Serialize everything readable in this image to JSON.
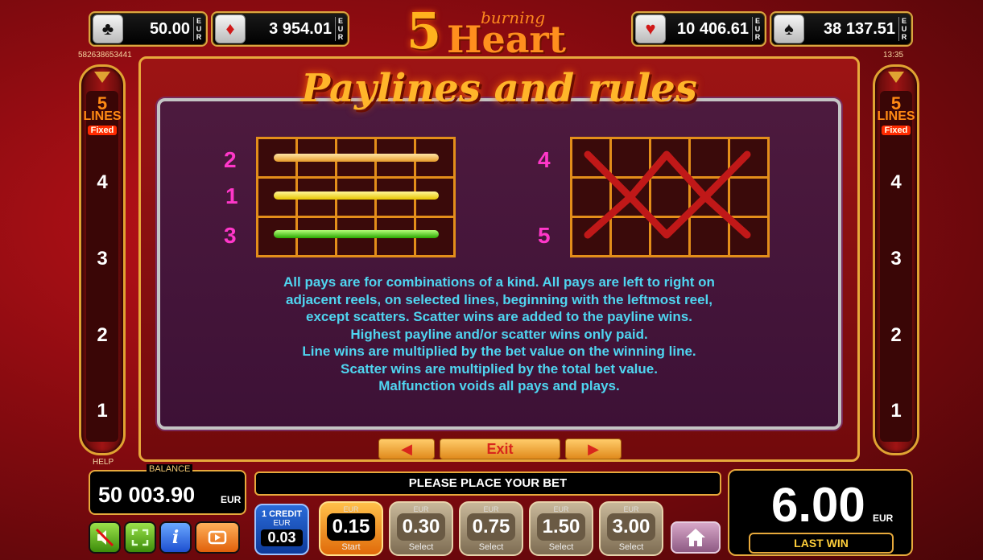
{
  "jackpots": [
    {
      "suit_icon": "clubs-icon",
      "glyph": "♣",
      "value": "50.00",
      "currency": "E U R"
    },
    {
      "suit_icon": "diamonds-icon",
      "glyph": "♦",
      "value": "3 954.01",
      "currency": "E U R"
    },
    {
      "suit_icon": "hearts-icon",
      "glyph": "♥",
      "value": "10 406.61",
      "currency": "E U R"
    },
    {
      "suit_icon": "spades-icon",
      "glyph": "♠",
      "value": "38 137.51",
      "currency": "E U R"
    }
  ],
  "logo": {
    "number": "5",
    "small": "burning",
    "word": "Heart"
  },
  "session_id": "582638653441",
  "clock": "13:35",
  "side": {
    "count": "5",
    "lines": "LINES",
    "fixed": "Fixed",
    "numbers": [
      "4",
      "3",
      "2",
      "1"
    ]
  },
  "panel": {
    "title": "Paylines and rules",
    "left_lines": [
      "2",
      "1",
      "3"
    ],
    "right_lines": [
      "4",
      "5"
    ],
    "rules": [
      "All pays are for combinations of a kind. All pays are left to right on",
      "adjacent reels, on selected lines, beginning with the leftmost reel,",
      "except scatters. Scatter wins are added to the payline wins.",
      "Highest payline and/or scatter wins only paid.",
      "Line wins are multiplied by the bet value on the winning line.",
      "Scatter wins are multiplied by the total bet value.",
      "Malfunction voids all pays and plays."
    ],
    "prev": "◀",
    "exit": "Exit",
    "next": "▶"
  },
  "bottom": {
    "help": "HELP",
    "balance_label": "BALANCE",
    "balance": "50 003.90",
    "balance_currency": "EUR",
    "message": "PLEASE PLACE YOUR BET",
    "credit": {
      "line1": "1 CREDIT",
      "line2": "EUR",
      "value": "0.03"
    },
    "bets": [
      {
        "currency": "EUR",
        "value": "0.15",
        "label": "Start",
        "active": true
      },
      {
        "currency": "EUR",
        "value": "0.30",
        "label": "Select",
        "active": false
      },
      {
        "currency": "EUR",
        "value": "0.75",
        "label": "Select",
        "active": false
      },
      {
        "currency": "EUR",
        "value": "1.50",
        "label": "Select",
        "active": false
      },
      {
        "currency": "EUR",
        "value": "3.00",
        "label": "Select",
        "active": false
      }
    ],
    "last_win": "6.00",
    "last_win_currency": "EUR",
    "last_win_label": "LAST WIN"
  },
  "colors": {
    "accent_gold": "#e7a93c",
    "rules_text": "#4fd5f0",
    "background_red": "#a01414"
  }
}
